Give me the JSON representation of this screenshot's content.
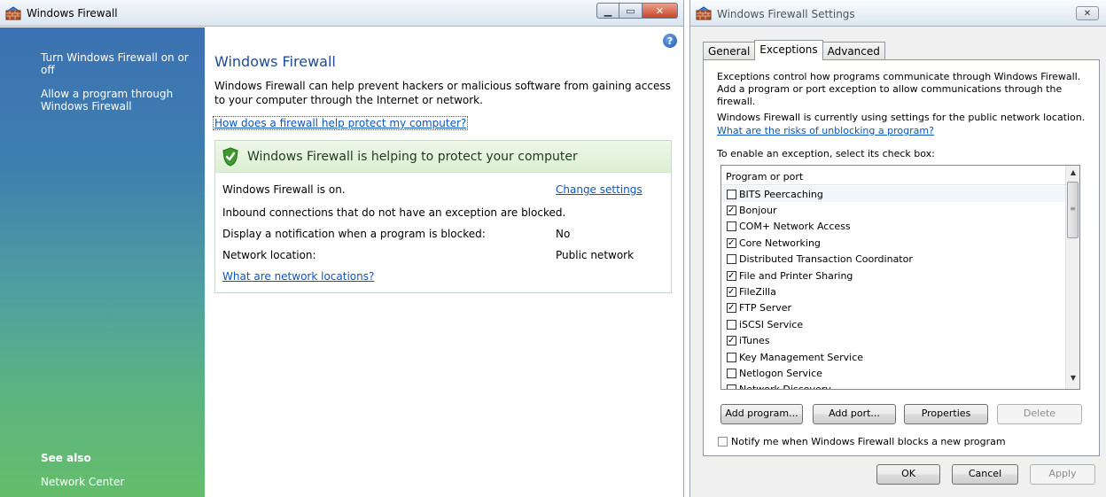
{
  "firewall_window": {
    "title": "Windows Firewall",
    "sidebar": {
      "links": [
        "Turn Windows Firewall on or off",
        "Allow a program through Windows Firewall"
      ],
      "see_also": "See also",
      "see_also_links": [
        "Network Center"
      ]
    },
    "main": {
      "heading": "Windows Firewall",
      "description": "Windows Firewall can help prevent hackers or malicious software from gaining access to your computer through the Internet or network.",
      "help_link": "How does a firewall help protect my computer?",
      "status_banner": "Windows Firewall is helping to protect your computer",
      "rows": [
        {
          "label": "Windows Firewall is on.",
          "value": "Change settings"
        },
        {
          "label": "Inbound connections that do not have an exception are blocked.",
          "value": ""
        },
        {
          "label": "Display a notification when a program is blocked:",
          "value": "No"
        },
        {
          "label": "Network location:",
          "value": "Public network"
        }
      ],
      "network_link": "What are network locations?"
    },
    "colors": {
      "heading": "#1e4b92",
      "link": "#0b55c4"
    }
  },
  "settings_window": {
    "title": "Windows Firewall Settings",
    "close_label": "✕",
    "tabs": [
      "General",
      "Exceptions",
      "Advanced"
    ],
    "active_tab": "Exceptions",
    "intro": "Exceptions control how programs communicate through Windows Firewall. Add a program or port exception to allow communications through the firewall.",
    "location_text": "Windows Firewall is currently using settings for the public network location.",
    "risk_link": "What are the risks of unblocking a program?",
    "instruction": "To enable an exception, select its check box:",
    "list_header": "Program or port",
    "items": [
      {
        "label": "BITS Peercaching",
        "checked": false
      },
      {
        "label": "Bonjour",
        "checked": true
      },
      {
        "label": "COM+ Network Access",
        "checked": false
      },
      {
        "label": "Core Networking",
        "checked": true
      },
      {
        "label": "Distributed Transaction Coordinator",
        "checked": false
      },
      {
        "label": "File and Printer Sharing",
        "checked": true
      },
      {
        "label": "FileZilla",
        "checked": true
      },
      {
        "label": "FTP Server",
        "checked": true
      },
      {
        "label": "iSCSI Service",
        "checked": false
      },
      {
        "label": "iTunes",
        "checked": true
      },
      {
        "label": "Key Management Service",
        "checked": false
      },
      {
        "label": "Netlogon Service",
        "checked": false
      },
      {
        "label": "Network Discovery",
        "checked": false
      }
    ],
    "buttons": {
      "add_program": "Add program...",
      "add_port": "Add port...",
      "properties": "Properties",
      "delete": "Delete",
      "ok": "OK",
      "cancel": "Cancel",
      "apply": "Apply"
    },
    "notify_label": "Notify me when Windows Firewall blocks a new program",
    "notify_checked": false
  }
}
